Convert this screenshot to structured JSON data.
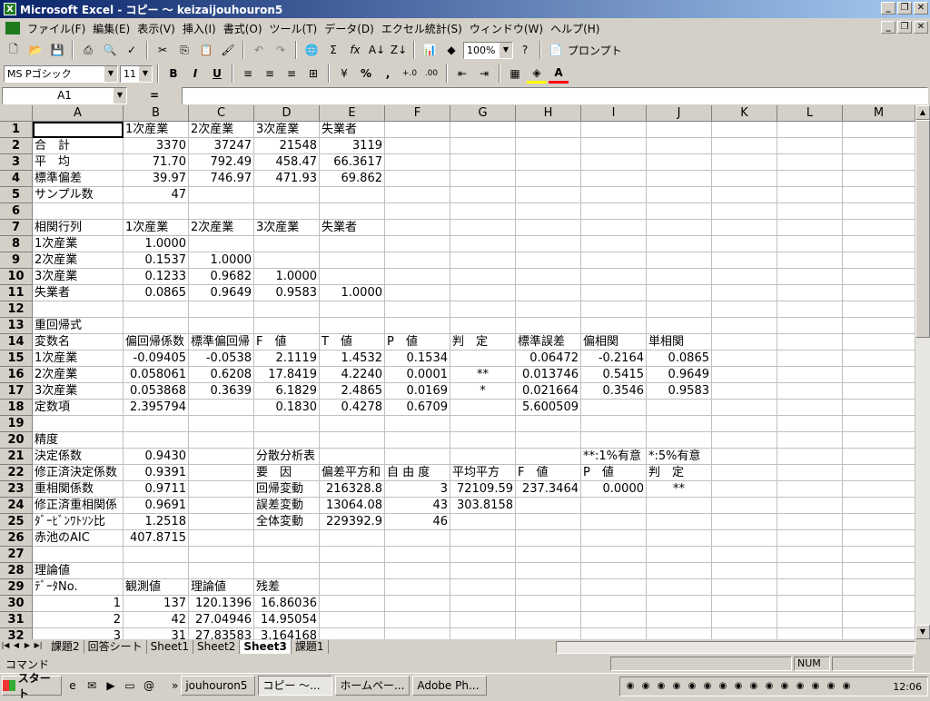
{
  "window": {
    "title": "Microsoft Excel - コピー ～ keizaijouhouron5"
  },
  "menu": [
    "ファイル(F)",
    "編集(E)",
    "表示(V)",
    "挿入(I)",
    "書式(O)",
    "ツール(T)",
    "データ(D)",
    "エクセル統計(S)",
    "ウィンドウ(W)",
    "ヘルプ(H)"
  ],
  "toolbar1": {
    "zoom": "100%",
    "pdf_label": "プロンプト"
  },
  "toolbar2": {
    "font": "MS Pゴシック",
    "size": "11",
    "bold": "B",
    "italic": "I",
    "underline": "U",
    "percent": "%",
    "comma": ","
  },
  "formula": {
    "namebox": "A1",
    "eq": "=",
    "content": ""
  },
  "columns": [
    "A",
    "B",
    "C",
    "D",
    "E",
    "F",
    "G",
    "H",
    "I",
    "J",
    "K",
    "L",
    "M"
  ],
  "rows": [
    {
      "n": "1",
      "cells": {
        "B": "1次産業",
        "C": "2次産業",
        "D": "3次産業",
        "E": "失業者"
      }
    },
    {
      "n": "2",
      "cells": {
        "A": "合　計",
        "B": "3370",
        "C": "37247",
        "D": "21548",
        "E": "3119"
      }
    },
    {
      "n": "3",
      "cells": {
        "A": "平　均",
        "B": "71.70",
        "C": "792.49",
        "D": "458.47",
        "E": "66.3617"
      }
    },
    {
      "n": "4",
      "cells": {
        "A": "標準偏差",
        "B": "39.97",
        "C": "746.97",
        "D": "471.93",
        "E": "69.862"
      }
    },
    {
      "n": "5",
      "cells": {
        "A": "サンプル数",
        "B": "47"
      }
    },
    {
      "n": "6",
      "cells": {}
    },
    {
      "n": "7",
      "cells": {
        "A": "相関行列",
        "B": "1次産業",
        "C": "2次産業",
        "D": "3次産業",
        "E": "失業者"
      }
    },
    {
      "n": "8",
      "cells": {
        "A": "1次産業",
        "B": "1.0000"
      }
    },
    {
      "n": "9",
      "cells": {
        "A": "2次産業",
        "B": "0.1537",
        "C": "1.0000"
      }
    },
    {
      "n": "10",
      "cells": {
        "A": "3次産業",
        "B": "0.1233",
        "C": "0.9682",
        "D": "1.0000"
      }
    },
    {
      "n": "11",
      "cells": {
        "A": "失業者",
        "B": "0.0865",
        "C": "0.9649",
        "D": "0.9583",
        "E": "1.0000"
      }
    },
    {
      "n": "12",
      "cells": {}
    },
    {
      "n": "13",
      "cells": {
        "A": "重回帰式"
      }
    },
    {
      "n": "14",
      "cells": {
        "A": "変数名",
        "B": "偏回帰係数",
        "C": "標準偏回帰",
        "D": "F　値",
        "E": "T　値",
        "F": "P　値",
        "G": "判　定",
        "H": "標準誤差",
        "I": "偏相関",
        "J": "単相関"
      }
    },
    {
      "n": "15",
      "cells": {
        "A": "1次産業",
        "B": "-0.09405",
        "C": "-0.0538",
        "D": "2.1119",
        "E": "1.4532",
        "F": "0.1534",
        "H": "0.06472",
        "I": "-0.2164",
        "J": "0.0865"
      }
    },
    {
      "n": "16",
      "cells": {
        "A": "2次産業",
        "B": "0.058061",
        "C": "0.6208",
        "D": "17.8419",
        "E": "4.2240",
        "F": "0.0001",
        "G": "**",
        "H": "0.013746",
        "I": "0.5415",
        "J": "0.9649"
      }
    },
    {
      "n": "17",
      "cells": {
        "A": "3次産業",
        "B": "0.053868",
        "C": "0.3639",
        "D": "6.1829",
        "E": "2.4865",
        "F": "0.0169",
        "G": "*",
        "H": "0.021664",
        "I": "0.3546",
        "J": "0.9583"
      }
    },
    {
      "n": "18",
      "cells": {
        "A": "定数項",
        "B": "2.395794",
        "D": "0.1830",
        "E": "0.4278",
        "F": "0.6709",
        "H": "5.600509"
      }
    },
    {
      "n": "19",
      "cells": {}
    },
    {
      "n": "20",
      "cells": {
        "A": "精度"
      }
    },
    {
      "n": "21",
      "cells": {
        "A": "決定係数",
        "B": "0.9430",
        "D": "分散分析表",
        "I": "**:1%有意",
        "J": "*:5%有意"
      }
    },
    {
      "n": "22",
      "cells": {
        "A": "修正済決定係数",
        "B": "0.9391",
        "D": "要　因",
        "E": "偏差平方和",
        "F": "自 由 度",
        "G": "平均平方",
        "H": "F　値",
        "I": "P　値",
        "J": "判　定"
      }
    },
    {
      "n": "23",
      "cells": {
        "A": "重相関係数",
        "B": "0.9711",
        "D": "回帰変動",
        "E": "216328.8",
        "F": "3",
        "G": "72109.59",
        "H": "237.3464",
        "I": "0.0000",
        "J": "**"
      }
    },
    {
      "n": "24",
      "cells": {
        "A": "修正済重相関係",
        "B": "0.9691",
        "D": "誤差変動",
        "E": "13064.08",
        "F": "43",
        "G": "303.8158"
      }
    },
    {
      "n": "25",
      "cells": {
        "A": "ﾀﾞｰﾋﾞﾝﾜﾄｿﾝ比",
        "B": "1.2518",
        "D": "全体変動",
        "E": "229392.9",
        "F": "46"
      }
    },
    {
      "n": "26",
      "cells": {
        "A": "赤池のAIC",
        "B": "407.8715"
      }
    },
    {
      "n": "27",
      "cells": {}
    },
    {
      "n": "28",
      "cells": {
        "A": "理論値"
      }
    },
    {
      "n": "29",
      "cells": {
        "A": "ﾃﾞｰﾀNo.",
        "B": "観測値",
        "C": "理論値",
        "D": "残差"
      }
    },
    {
      "n": "30",
      "cells": {
        "A": "1",
        "B": "137",
        "C": "120.1396",
        "D": "16.86036"
      }
    },
    {
      "n": "31",
      "cells": {
        "A": "2",
        "B": "42",
        "C": "27.04946",
        "D": "14.95054"
      }
    },
    {
      "n": "32",
      "cells": {
        "A": "3",
        "B": "31",
        "C": "27.83583",
        "D": "3.164168"
      }
    }
  ],
  "sheets": [
    "課題2",
    "回答シート",
    "Sheet1",
    "Sheet2",
    "Sheet3",
    "課題1"
  ],
  "active_sheet": "Sheet3",
  "status": {
    "text": "コマンド",
    "num": "NUM"
  },
  "taskbar": {
    "start": "スタート",
    "more": "»",
    "tasks": [
      "jouhouron5",
      "コピー ～...",
      "ホームペー...",
      "Adobe Ph..."
    ],
    "active_task": "コピー ～...",
    "clock": "12:06"
  }
}
